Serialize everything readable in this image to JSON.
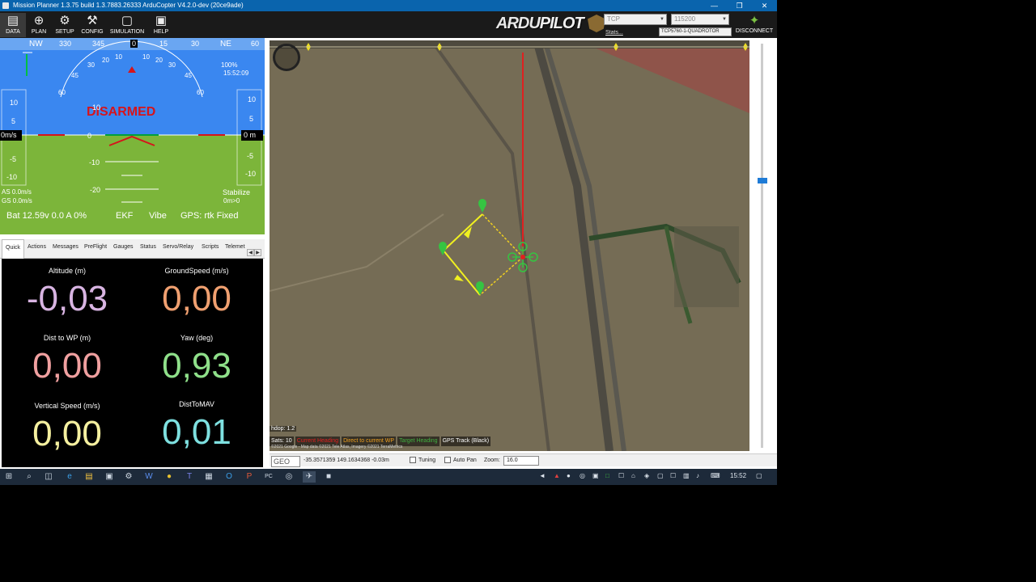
{
  "window": {
    "title": "Mission Planner 1.3.75 build 1.3.7883.26333 ArduCopter V4.2.0-dev (20ce9ade)",
    "controls": [
      "—",
      "❐",
      "✕"
    ]
  },
  "toolbar": {
    "items": [
      {
        "label": "DATA",
        "icon": "monitor-icon",
        "glyph": "▤"
      },
      {
        "label": "PLAN",
        "icon": "globe-icon",
        "glyph": "⊕"
      },
      {
        "label": "SETUP",
        "icon": "gears-icon",
        "glyph": "⚙"
      },
      {
        "label": "CONFIG",
        "icon": "wrench-icon",
        "glyph": "⚒"
      },
      {
        "label": "SIMULATION",
        "icon": "simulation-icon",
        "glyph": "▢"
      },
      {
        "label": "HELP",
        "icon": "help-icon",
        "glyph": "▣"
      }
    ],
    "logo": {
      "ardu": "ARDU",
      "pilot": "PILOT"
    },
    "connection_type": "TCP",
    "baud": "115200",
    "stats_link": "Stats...",
    "connection_info": "TCP5760-1-QUADROTOR",
    "disconnect_label": "DISCONNECT"
  },
  "hud": {
    "heading": [
      "NW",
      "330",
      "345",
      "0",
      "15",
      "30",
      "NE",
      "60"
    ],
    "disarmed": "DISARMED",
    "clock": "15:52:09",
    "battery_pct": "100%",
    "speed": "0m/s",
    "altitude": "0 m",
    "left_tape": [
      "10",
      "5",
      "-5",
      "-10"
    ],
    "right_tape": [
      "10",
      "5",
      "-5",
      "-10"
    ],
    "pitch_ladder": [
      "10",
      "-10",
      "-20"
    ],
    "roll_scale": [
      "60",
      "45",
      "30",
      "20",
      "10",
      "10",
      "20",
      "30",
      "45",
      "60"
    ],
    "pitch_zero": "0",
    "airspeed": "AS 0.0m/s",
    "groundspeed": "GS 0.0m/s",
    "mode": "Stabilize",
    "dist": "0m>0",
    "battery": "Bat 12.59v 0.0 A 0%",
    "ekf": "EKF",
    "vibe": "Vibe",
    "gps": "GPS: rtk Fixed"
  },
  "tabs": [
    "Quick",
    "Actions",
    "Messages",
    "PreFlight",
    "Gauges",
    "Status",
    "Servo/Relay",
    "Scripts",
    "Telemet"
  ],
  "tab_arrows": {
    "left": "◀",
    "right": "▶"
  },
  "quick": [
    {
      "label": "Altitude (m)",
      "value": "-0,03",
      "color": "#d8b4e2"
    },
    {
      "label": "GroundSpeed (m/s)",
      "value": "0,00",
      "color": "#f0a070"
    },
    {
      "label": "Dist to WP (m)",
      "value": "0,00",
      "color": "#f0a0a0"
    },
    {
      "label": "Yaw (deg)",
      "value": "0,93",
      "color": "#8fe08a"
    },
    {
      "label": "Vertical Speed (m/s)",
      "value": "0,00",
      "color": "#f5f0a0"
    },
    {
      "label": "DistToMAV",
      "value": "0,01",
      "color": "#7ee0e0"
    }
  ],
  "map": {
    "hdop": "hdop: 1.2",
    "legend": [
      {
        "label": "Sats: 10",
        "color": "#ffffff"
      },
      {
        "label": "Current Heading",
        "color": "#e02020"
      },
      {
        "label": "Direct to current WP",
        "color": "#f0a020"
      },
      {
        "label": "Target Heading",
        "color": "#40b040"
      },
      {
        "label": "GPS Track (Black)",
        "color": "#ffffff"
      }
    ],
    "copyright": "©2021 Google - Map data ©2021 Tele Atlas, Imagery ©2021 TerraMetrics"
  },
  "mapbar": {
    "projection": "GEO",
    "coords": "-35.3571359 149.1634368   -0.03m",
    "tuning_label": "Tuning",
    "autopan_label": "Auto Pan",
    "zoom_label": "Zoom:",
    "zoom_value": "16.0"
  },
  "taskbar": {
    "time": "15:52",
    "icons": [
      "start-icon",
      "search-icon",
      "taskview-icon",
      "edge-icon",
      "explorer-icon",
      "store-icon",
      "settings-icon",
      "word-icon",
      "chrome-icon",
      "teams-icon",
      "files-icon",
      "outlook-icon",
      "powerpoint-icon",
      "pycharm-icon",
      "github-icon",
      "missionplanner-icon",
      "terminal-icon"
    ],
    "glyphs": [
      "⊞",
      "⌕",
      "◫",
      "e",
      "▤",
      "▣",
      "⚙",
      "W",
      "●",
      "T",
      "▦",
      "O",
      "P",
      "PC",
      "◎",
      "✈",
      "■"
    ],
    "tray": [
      "◄",
      "▲",
      "●",
      "◎",
      "▣",
      "□",
      "☐",
      "⌂",
      "◈",
      "▢",
      "☐",
      "▥",
      "♪",
      "⌨"
    ]
  }
}
